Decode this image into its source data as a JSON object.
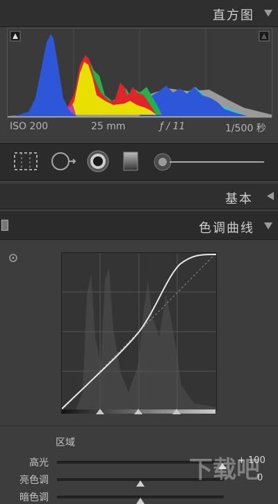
{
  "histogram_panel": {
    "title": "直方图",
    "iso": "ISO 200",
    "focal_length": "25 mm",
    "aperture": "ƒ / 11",
    "shutter": "1/500 秒"
  },
  "basic_panel": {
    "title": "基本"
  },
  "tone_curve_panel": {
    "title": "色调曲线",
    "region_label": "区域",
    "sliders": [
      {
        "label": "高光",
        "value": "+ 100",
        "position": 0.93
      },
      {
        "label": "亮色调",
        "value": "0",
        "position": 0.5
      },
      {
        "label": "暗色调",
        "value": "",
        "position": 0.5
      }
    ],
    "split_points": [
      0.25,
      0.5,
      0.75
    ]
  },
  "watermark": {
    "text": "下载吧"
  },
  "colors": {
    "panel_bg": "#3d3d3d",
    "header_bg": "#2f2f2f",
    "histo_blue": "#2e56d8",
    "histo_yellow": "#e8e000",
    "histo_green": "#22b24a",
    "histo_red": "#e0242a",
    "histo_cyan": "#26c8d0",
    "histo_gray": "#9a9a9a"
  }
}
